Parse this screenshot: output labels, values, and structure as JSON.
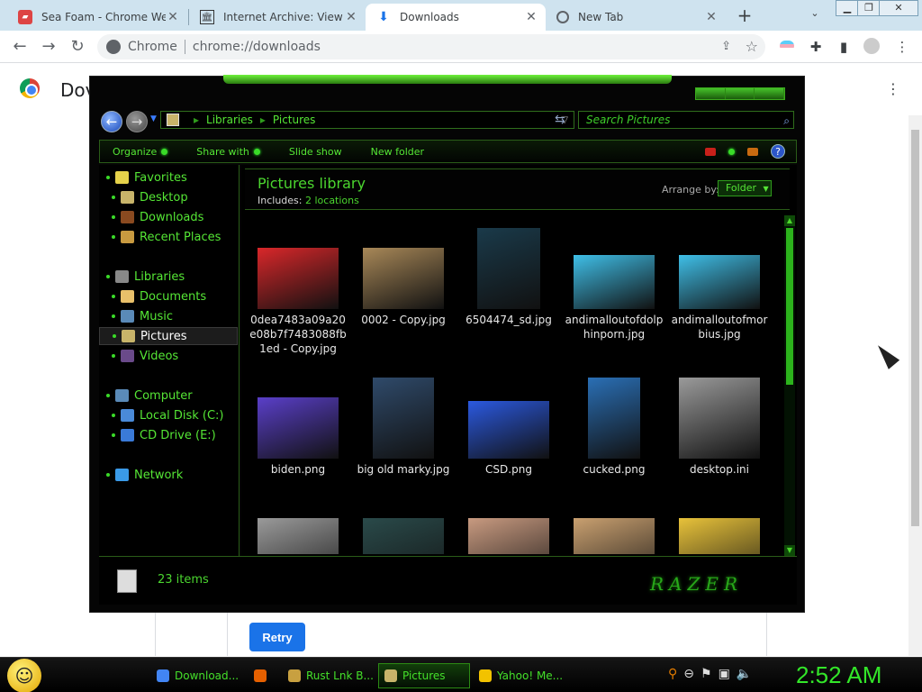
{
  "browser": {
    "tabs": [
      {
        "title": "Sea Foam - Chrome Web",
        "icon": "sea-foam-icon",
        "active": false
      },
      {
        "title": "Internet Archive: View Ar",
        "icon": "archive-icon",
        "active": false
      },
      {
        "title": "Downloads",
        "icon": "download-icon",
        "active": true
      },
      {
        "title": "New Tab",
        "icon": "chrome-icon",
        "active": false
      }
    ],
    "new_tab": "+",
    "omnibox": {
      "origin": "Chrome",
      "url": "chrome://downloads"
    }
  },
  "downloads_page": {
    "title": "Dov",
    "retry_label": "Retry"
  },
  "explorer": {
    "address": {
      "part1": "Libraries",
      "part2": "Pictures",
      "sep": "▸"
    },
    "search_placeholder": "Search Pictures",
    "commands": [
      "Organize",
      "Share with",
      "Slide show",
      "New folder"
    ],
    "nav": [
      {
        "label": "Favorites",
        "level": 0,
        "icon": "star-icon"
      },
      {
        "label": "Desktop",
        "level": 1,
        "icon": "desktop-icon"
      },
      {
        "label": "Downloads",
        "level": 1,
        "icon": "downloads-folder-icon"
      },
      {
        "label": "Recent Places",
        "level": 1,
        "icon": "recent-places-icon"
      },
      {
        "label": "Libraries",
        "level": 0,
        "icon": "libraries-icon"
      },
      {
        "label": "Documents",
        "level": 1,
        "icon": "documents-icon"
      },
      {
        "label": "Music",
        "level": 1,
        "icon": "music-icon"
      },
      {
        "label": "Pictures",
        "level": 1,
        "icon": "pictures-icon",
        "selected": true
      },
      {
        "label": "Videos",
        "level": 1,
        "icon": "videos-icon"
      },
      {
        "label": "Computer",
        "level": 0,
        "icon": "computer-icon"
      },
      {
        "label": "Local Disk (C:)",
        "level": 1,
        "icon": "disk-icon"
      },
      {
        "label": "CD Drive (E:)",
        "level": 1,
        "icon": "cd-drive-icon"
      },
      {
        "label": "Network",
        "level": 0,
        "icon": "network-icon"
      }
    ],
    "library": {
      "title": "Pictures library",
      "includes_label": "Includes:",
      "locations": "2 locations",
      "arrange_label": "Arrange by:",
      "arrange_value": "Folder"
    },
    "files": [
      {
        "name": "0dea7483a09a20e08b7f7483088fb1ed - Copy.jpg",
        "color": "#d9272a"
      },
      {
        "name": "0002 - Copy.jpg",
        "color": "#a88858"
      },
      {
        "name": "6504474_sd.jpg",
        "color": "#1a3a4a"
      },
      {
        "name": "andimalloutofdolphinporn.jpg",
        "color": "#3fbfe8"
      },
      {
        "name": "andimalloutofmorbius.jpg",
        "color": "#3fbfe8"
      },
      {
        "name": "biden.png",
        "color": "#5a3fc9"
      },
      {
        "name": "big old marky.jpg",
        "color": "#2f4a6a"
      },
      {
        "name": "CSD.png",
        "color": "#2b59e0"
      },
      {
        "name": "cucked.png",
        "color": "#2a6fb5"
      },
      {
        "name": "desktop.ini",
        "color": "#9a9a9a"
      },
      {
        "name": "",
        "color": "#9a9a9a"
      },
      {
        "name": "",
        "color": "#2a4a4a"
      },
      {
        "name": "",
        "color": "#c89a80"
      },
      {
        "name": "",
        "color": "#c9a070"
      },
      {
        "name": "",
        "color": "#e8c23a"
      }
    ],
    "status": "23 items",
    "brand": "RAZER"
  },
  "taskbar": {
    "items": [
      {
        "label": "Download...",
        "color": "#4285f4",
        "active": false
      },
      {
        "label": "",
        "color": "#e66000",
        "active": false
      },
      {
        "label": "Rust Lnk B...",
        "color": "#c8a040",
        "active": false
      },
      {
        "label": "Pictures",
        "color": "#c8b46a",
        "active": true
      },
      {
        "label": "Yahoo! Me...",
        "color": "#f2c200",
        "active": false
      }
    ],
    "clock": "2:52 AM"
  }
}
